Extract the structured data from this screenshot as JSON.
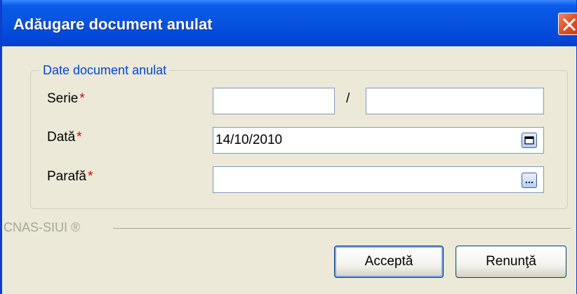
{
  "window": {
    "title": "Adăugare document anulat"
  },
  "groupbox": {
    "legend": "Date document anulat"
  },
  "fields": {
    "serie": {
      "label": "Serie",
      "value_left": "",
      "value_right": "",
      "separator": "/"
    },
    "data": {
      "label": "Dată",
      "value": "14/10/2010"
    },
    "parafa": {
      "label": "Parafă",
      "value": ""
    },
    "required_mark": "*"
  },
  "footer": {
    "label": "CNAS-SIUI ®"
  },
  "buttons": {
    "accept_label": "Acceptă",
    "cancel_label": "Renunţă"
  },
  "colors": {
    "title_bar": "#0754e0",
    "legend_text": "#0046d5",
    "required": "#e00000",
    "close_button": "#e0532c"
  },
  "icons": [
    "close-icon",
    "calendar-icon",
    "ellipsis-icon"
  ]
}
